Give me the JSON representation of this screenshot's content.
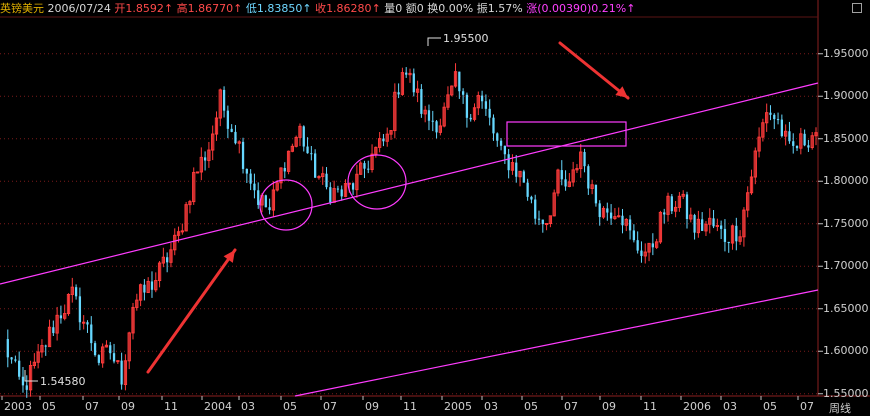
{
  "header": {
    "symbol": "英镑美元",
    "date": "2006/07/24",
    "open_label": "开",
    "open_value": "1.8592",
    "high_label": "高",
    "high_value": "1.86770",
    "low_label": "低",
    "low_value": "1.83850",
    "close_label": "收",
    "close_value": "1.86280",
    "volume_label": "量",
    "volume_value": "0",
    "amount_label": "额",
    "amount_value": "0",
    "turnover_label": "换",
    "turnover_value": "0.00%",
    "amplitude_label": "振",
    "amplitude_value": "1.57%",
    "change_label": "涨",
    "change_value": "(0.00390)",
    "change_pct": "0.21%"
  },
  "period_label": "周线",
  "colors": {
    "background": "#000000",
    "up": "#ff3b3b",
    "down": "#66d8ff",
    "trendline": "#ff3cff",
    "arrow": "#ee3333",
    "grid": "#7a1b1b"
  },
  "chart_data": {
    "type": "candlestick",
    "symbol": "英镑美元",
    "ylim": [
      1.545,
      1.96
    ],
    "y_ticks": [
      "1.95000",
      "1.90000",
      "1.85000",
      "1.80000",
      "1.75000",
      "1.70000",
      "1.65000",
      "1.60000",
      "1.55000"
    ],
    "x_ticks": [
      "2003",
      "05",
      "07",
      "09",
      "11",
      "2004",
      "03",
      "05",
      "07",
      "09",
      "11",
      "2005",
      "03",
      "05",
      "07",
      "09",
      "11",
      "2006",
      "03",
      "05",
      "07"
    ],
    "annotations": [
      {
        "text": "1.95500",
        "value": 1.955
      },
      {
        "text": "1.54580",
        "value": 1.5458
      }
    ],
    "anchors": [
      {
        "t": 0,
        "v": 1.61
      },
      {
        "t": 3,
        "v": 1.575
      },
      {
        "t": 5,
        "v": 1.555
      },
      {
        "t": 9,
        "v": 1.59
      },
      {
        "t": 14,
        "v": 1.64
      },
      {
        "t": 18,
        "v": 1.665
      },
      {
        "t": 22,
        "v": 1.625
      },
      {
        "t": 25,
        "v": 1.59
      },
      {
        "t": 28,
        "v": 1.6
      },
      {
        "t": 31,
        "v": 1.57
      },
      {
        "t": 34,
        "v": 1.655
      },
      {
        "t": 40,
        "v": 1.685
      },
      {
        "t": 46,
        "v": 1.735
      },
      {
        "t": 50,
        "v": 1.805
      },
      {
        "t": 54,
        "v": 1.84
      },
      {
        "t": 57,
        "v": 1.895
      },
      {
        "t": 61,
        "v": 1.855
      },
      {
        "t": 64,
        "v": 1.815
      },
      {
        "t": 67,
        "v": 1.78
      },
      {
        "t": 70,
        "v": 1.765
      },
      {
        "t": 74,
        "v": 1.825
      },
      {
        "t": 78,
        "v": 1.86
      },
      {
        "t": 81,
        "v": 1.82
      },
      {
        "t": 85,
        "v": 1.79
      },
      {
        "t": 89,
        "v": 1.785
      },
      {
        "t": 93,
        "v": 1.8
      },
      {
        "t": 97,
        "v": 1.83
      },
      {
        "t": 101,
        "v": 1.85
      },
      {
        "t": 105,
        "v": 1.935
      },
      {
        "t": 108,
        "v": 1.91
      },
      {
        "t": 111,
        "v": 1.875
      },
      {
        "t": 115,
        "v": 1.87
      },
      {
        "t": 119,
        "v": 1.915
      },
      {
        "t": 122,
        "v": 1.88
      },
      {
        "t": 125,
        "v": 1.9
      },
      {
        "t": 128,
        "v": 1.87
      },
      {
        "t": 131,
        "v": 1.83
      },
      {
        "t": 134,
        "v": 1.82
      },
      {
        "t": 137,
        "v": 1.8
      },
      {
        "t": 140,
        "v": 1.76
      },
      {
        "t": 143,
        "v": 1.755
      },
      {
        "t": 146,
        "v": 1.8
      },
      {
        "t": 149,
        "v": 1.79
      },
      {
        "t": 152,
        "v": 1.835
      },
      {
        "t": 155,
        "v": 1.785
      },
      {
        "t": 158,
        "v": 1.765
      },
      {
        "t": 162,
        "v": 1.77
      },
      {
        "t": 166,
        "v": 1.725
      },
      {
        "t": 170,
        "v": 1.715
      },
      {
        "t": 174,
        "v": 1.765
      },
      {
        "t": 178,
        "v": 1.78
      },
      {
        "t": 182,
        "v": 1.745
      },
      {
        "t": 186,
        "v": 1.75
      },
      {
        "t": 190,
        "v": 1.735
      },
      {
        "t": 194,
        "v": 1.745
      },
      {
        "t": 198,
        "v": 1.83
      },
      {
        "t": 201,
        "v": 1.885
      },
      {
        "t": 204,
        "v": 1.87
      },
      {
        "t": 207,
        "v": 1.835
      },
      {
        "t": 210,
        "v": 1.845
      },
      {
        "t": 214,
        "v": 1.86
      }
    ]
  }
}
